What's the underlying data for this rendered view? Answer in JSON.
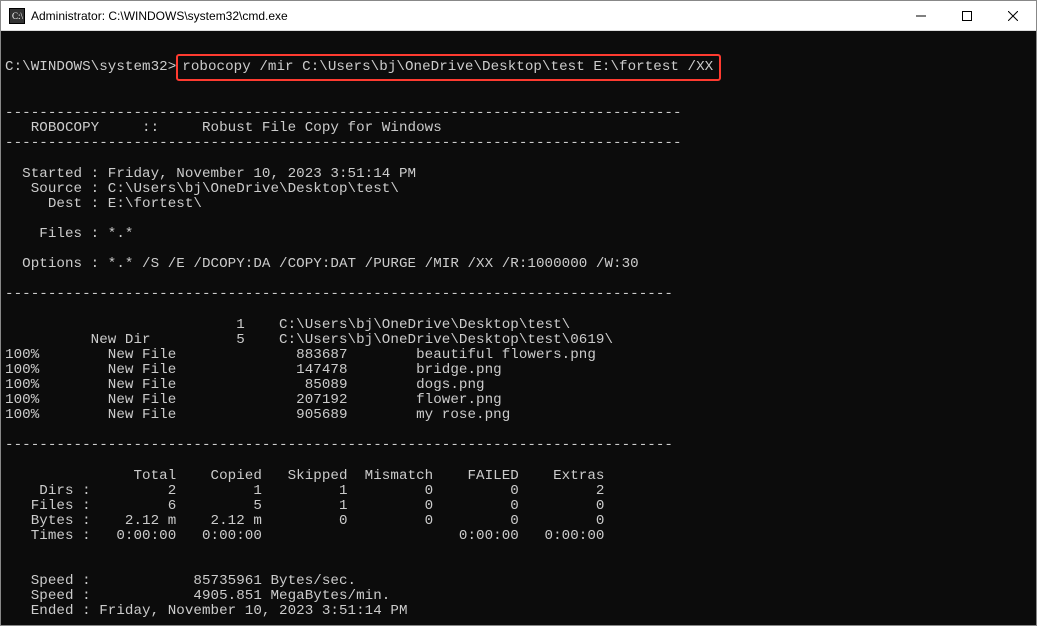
{
  "window": {
    "title": "Administrator: C:\\WINDOWS\\system32\\cmd.exe"
  },
  "prompt": {
    "path": "C:\\WINDOWS\\system32>",
    "command": "robocopy /mir C:\\Users\\bj\\OneDrive\\Desktop\\test E:\\fortest /XX"
  },
  "header": {
    "sep": "-------------------------------------------------------------------------------",
    "title": "   ROBOCOPY     ::     Robust File Copy for Windows                              "
  },
  "info": {
    "started": "  Started : Friday, November 10, 2023 3:51:14 PM",
    "source": "   Source : C:\\Users\\bj\\OneDrive\\Desktop\\test\\",
    "dest": "     Dest : E:\\fortest\\",
    "files": "    Files : *.*",
    "options": "  Options : *.* /S /E /DCOPY:DA /COPY:DAT /PURGE /MIR /XX /R:1000000 /W:30"
  },
  "sep_long": "------------------------------------------------------------------------------",
  "dirs": {
    "d1": "                           1    C:\\Users\\bj\\OneDrive\\Desktop\\test\\",
    "d2": "          New Dir          5    C:\\Users\\bj\\OneDrive\\Desktop\\test\\0619\\"
  },
  "files": {
    "f1": "100%        New File              883687        beautiful flowers.png",
    "f2": "100%        New File              147478        bridge.png",
    "f3": "100%        New File               85089        dogs.png",
    "f4": "100%        New File              207192        flower.png",
    "f5": "100%        New File              905689        my rose.png"
  },
  "stats": {
    "hdr": "               Total    Copied   Skipped  Mismatch    FAILED    Extras",
    "dirs": "    Dirs :         2         1         1         0         0         2",
    "files": "   Files :         6         5         1         0         0         0",
    "bytes": "   Bytes :    2.12 m    2.12 m         0         0         0         0",
    "times": "   Times :   0:00:00   0:00:00                       0:00:00   0:00:00"
  },
  "footer": {
    "speed1": "   Speed :            85735961 Bytes/sec.",
    "speed2": "   Speed :            4905.851 MegaBytes/min.",
    "ended": "   Ended : Friday, November 10, 2023 3:51:14 PM"
  }
}
